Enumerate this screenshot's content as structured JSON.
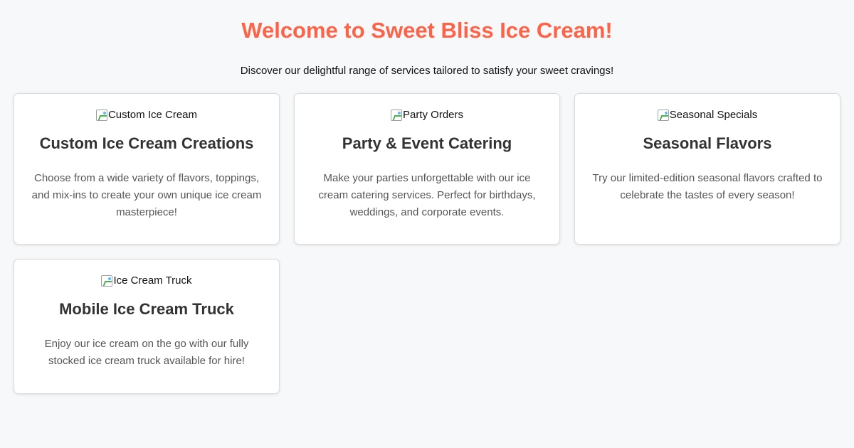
{
  "header": {
    "title": "Welcome to Sweet Bliss Ice Cream!",
    "subtitle": "Discover our delightful range of services tailored to satisfy your sweet cravings!"
  },
  "colors": {
    "title": "#ff6347",
    "background": "#f7f8fa",
    "card_background": "#ffffff"
  },
  "services": [
    {
      "image_alt": "Custom Ice Cream",
      "title": "Custom Ice Cream Creations",
      "description": "Choose from a wide variety of flavors, toppings, and mix-ins to create your own unique ice cream masterpiece!"
    },
    {
      "image_alt": "Party Orders",
      "title": "Party & Event Catering",
      "description": "Make your parties unforgettable with our ice cream catering services. Perfect for birthdays, weddings, and corporate events."
    },
    {
      "image_alt": "Seasonal Specials",
      "title": "Seasonal Flavors",
      "description": "Try our limited-edition seasonal flavors crafted to celebrate the tastes of every season!"
    },
    {
      "image_alt": "Ice Cream Truck",
      "title": "Mobile Ice Cream Truck",
      "description": "Enjoy our ice cream on the go with our fully stocked ice cream truck available for hire!"
    }
  ]
}
